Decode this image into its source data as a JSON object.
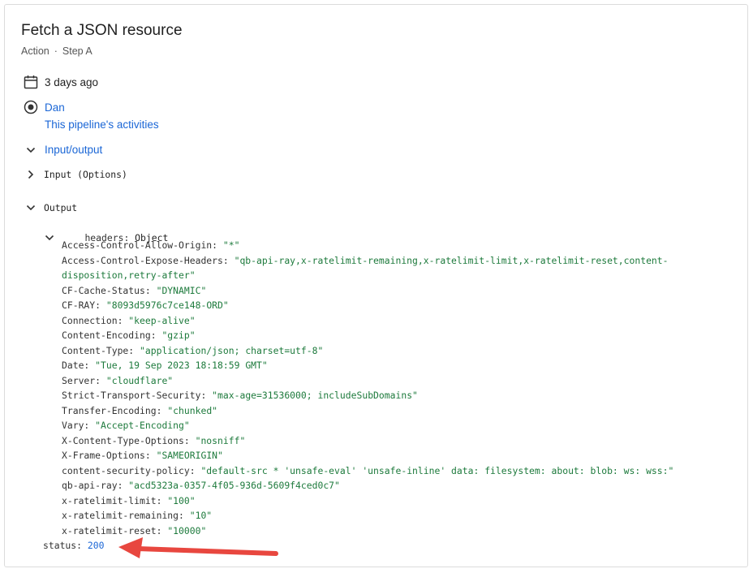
{
  "header": {
    "title": "Fetch a JSON resource",
    "type": "Action",
    "separator": "·",
    "step": "Step A"
  },
  "meta": {
    "time": "3 days ago",
    "user": "Dan",
    "activities_link": "This pipeline's activities"
  },
  "sections": {
    "io_label": "Input/output",
    "input_label": "Input (Options)",
    "output_label": "Output"
  },
  "output": {
    "headers_key": "headers:",
    "headers_type": "Object",
    "headers": [
      {
        "key": "Access-Control-Allow-Origin:",
        "value": "\"*\""
      },
      {
        "key": "Access-Control-Expose-Headers:",
        "value": "\"qb-api-ray,x-ratelimit-remaining,x-ratelimit-limit,x-ratelimit-reset,content-",
        "value2": "disposition,retry-after\""
      },
      {
        "key": "CF-Cache-Status:",
        "value": "\"DYNAMIC\""
      },
      {
        "key": "CF-RAY:",
        "value": "\"8093d5976c7ce148-ORD\""
      },
      {
        "key": "Connection:",
        "value": "\"keep-alive\""
      },
      {
        "key": "Content-Encoding:",
        "value": "\"gzip\""
      },
      {
        "key": "Content-Type:",
        "value": "\"application/json; charset=utf-8\""
      },
      {
        "key": "Date:",
        "value": "\"Tue, 19 Sep 2023 18:18:59 GMT\""
      },
      {
        "key": "Server:",
        "value": "\"cloudflare\""
      },
      {
        "key": "Strict-Transport-Security:",
        "value": "\"max-age=31536000; includeSubDomains\""
      },
      {
        "key": "Transfer-Encoding:",
        "value": "\"chunked\""
      },
      {
        "key": "Vary:",
        "value": "\"Accept-Encoding\""
      },
      {
        "key": "X-Content-Type-Options:",
        "value": "\"nosniff\""
      },
      {
        "key": "X-Frame-Options:",
        "value": "\"SAMEORIGIN\""
      },
      {
        "key": "content-security-policy:",
        "value": "\"default-src * 'unsafe-eval' 'unsafe-inline' data: filesystem: about: blob: ws: wss:\""
      },
      {
        "key": "qb-api-ray:",
        "value": "\"acd5323a-0357-4f05-936d-5609f4ced0c7\""
      },
      {
        "key": "x-ratelimit-limit:",
        "value": "\"100\""
      },
      {
        "key": "x-ratelimit-remaining:",
        "value": "\"10\""
      },
      {
        "key": "x-ratelimit-reset:",
        "value": "\"10000\""
      }
    ],
    "status_key": "status:",
    "status_value": "200"
  },
  "colors": {
    "link": "#1a66d6",
    "string_value": "#1d7a3c",
    "number_value": "#1a66d6",
    "annotation_arrow": "#e8473f"
  },
  "icons": {
    "time": "calendar-icon",
    "user": "record-circle-icon",
    "expand": "chevron-down-icon",
    "collapse": "chevron-right-icon"
  }
}
